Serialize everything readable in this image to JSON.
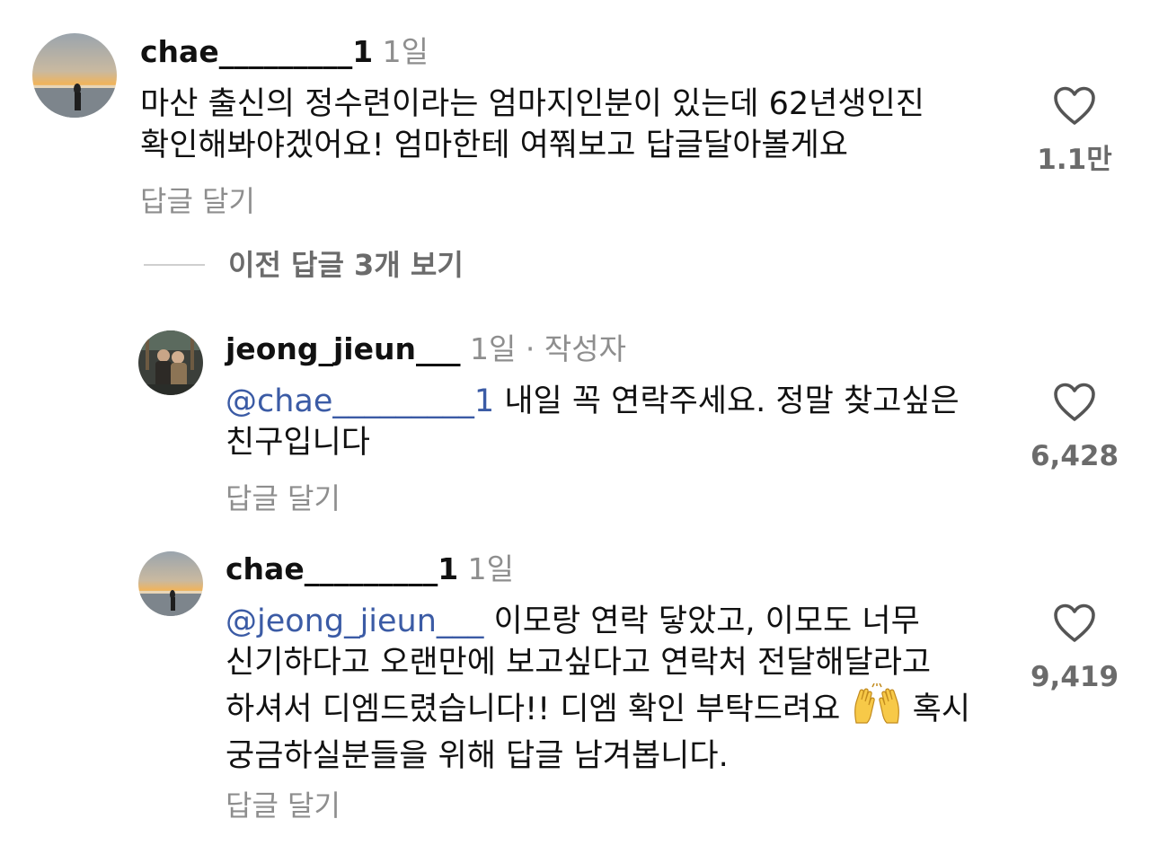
{
  "comments": [
    {
      "username": "chae_________1",
      "time": "1일",
      "text": "마산 출신의 정수련이라는 엄마지인분이 있는데 62년생인진 확인해봐야겠어요! 엄마한테 여쭤보고 답글달아볼게요",
      "reply_label": "답글 달기",
      "likes": "1.1만",
      "avatar_icon": "sunset-beach-photo"
    },
    {
      "username": "jeong_jieun___",
      "time": "1일",
      "separator": "·",
      "author_tag": "작성자",
      "mention": "@chae_________1",
      "text": " 내일 꼭 연락주세요. 정말 찾고싶은 친구입니다",
      "reply_label": "답글 달기",
      "likes": "6,428",
      "avatar_icon": "two-people-photo"
    },
    {
      "username": "chae_________1",
      "time": "1일",
      "mention": "@jeong_jieun___",
      "text": " 이모랑 연락 닿았고, 이모도 너무 신기하다고 오랜만에 보고싶다고 연락처 전달해달라고 하셔서 디엠드렸습니다!! 디엠 확인 부탁드려요",
      "emoji": "raising-hands",
      "text_after_emoji": " 혹시 궁금하실분들을 위해 답글 남겨봅니다.",
      "reply_label": "답글 달기",
      "likes": "9,419",
      "avatar_icon": "sunset-beach-photo"
    }
  ],
  "view_previous_replies": "이전 답글 3개 보기",
  "colors": {
    "mention": "#3b5ba5",
    "muted": "#8e8e8e",
    "text": "#111111"
  }
}
